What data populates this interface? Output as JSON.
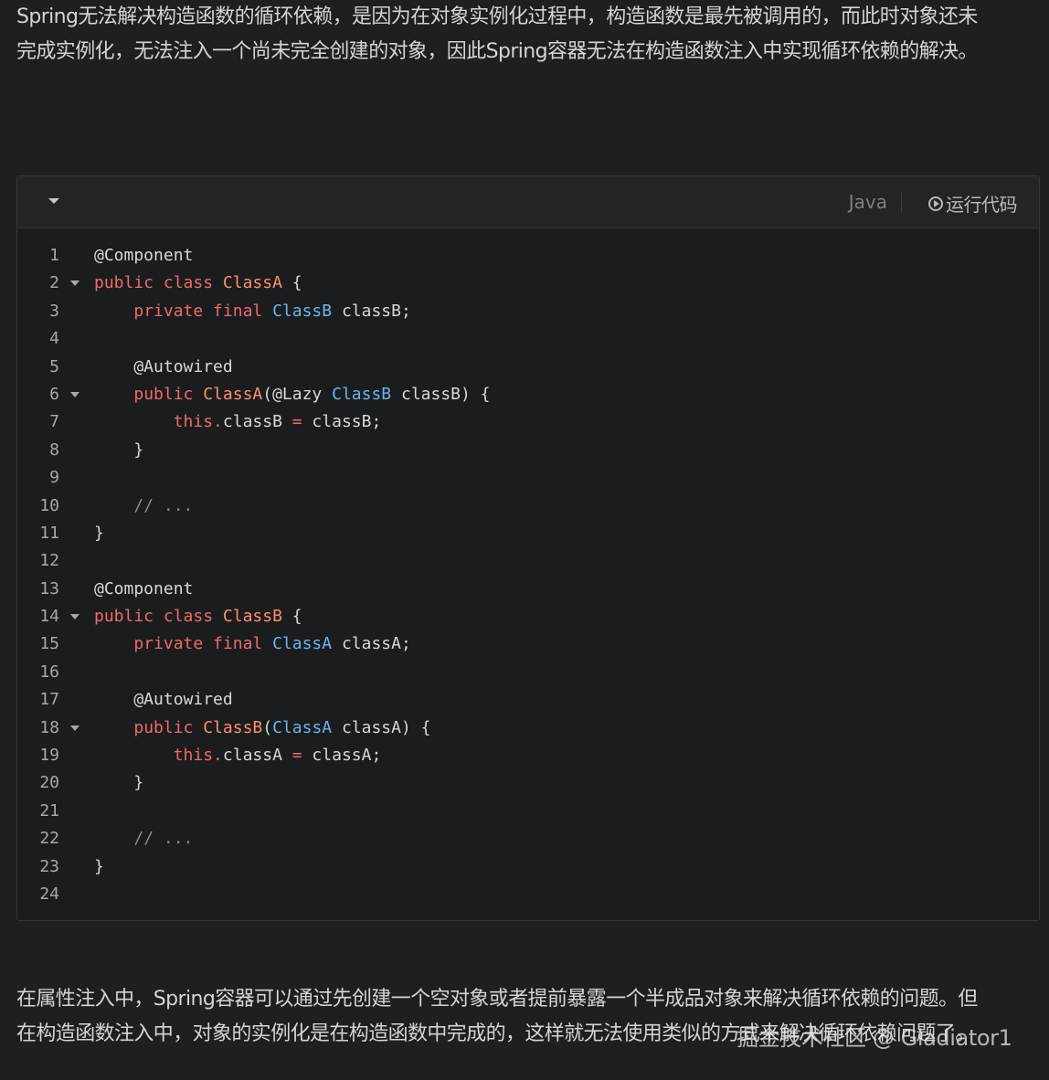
{
  "paragraph_top": {
    "lines": [
      "Spring无法解决构造函数的循环依赖，是因为在对象实例化过程中，构造函数是最先被调用的，而此时对象还未",
      "完成实例化，无法注入一个尚未完全创建的对象，因此Spring容器无法在构造函数注入中实现循环依赖的解决。"
    ]
  },
  "code_block": {
    "language": "Java",
    "run_label": "运行代码",
    "lines": [
      {
        "n": "1",
        "fold": false,
        "tokens": [
          {
            "t": "@Component",
            "c": "plain"
          }
        ]
      },
      {
        "n": "2",
        "fold": true,
        "tokens": [
          {
            "t": "public class ",
            "c": "kw"
          },
          {
            "t": "ClassA",
            "c": "cls"
          },
          {
            "t": " {",
            "c": "plain"
          }
        ]
      },
      {
        "n": "3",
        "fold": false,
        "tokens": [
          {
            "t": "    ",
            "c": "plain"
          },
          {
            "t": "private final ",
            "c": "kw"
          },
          {
            "t": "ClassB",
            "c": "type"
          },
          {
            "t": " classB;",
            "c": "plain"
          }
        ]
      },
      {
        "n": "4",
        "fold": false,
        "tokens": []
      },
      {
        "n": "5",
        "fold": false,
        "tokens": [
          {
            "t": "    @Autowired",
            "c": "plain"
          }
        ]
      },
      {
        "n": "6",
        "fold": true,
        "tokens": [
          {
            "t": "    ",
            "c": "plain"
          },
          {
            "t": "public ",
            "c": "kw"
          },
          {
            "t": "ClassA",
            "c": "cls"
          },
          {
            "t": "(@Lazy ",
            "c": "plain"
          },
          {
            "t": "ClassB",
            "c": "type"
          },
          {
            "t": " classB) {",
            "c": "plain"
          }
        ]
      },
      {
        "n": "7",
        "fold": false,
        "tokens": [
          {
            "t": "        ",
            "c": "plain"
          },
          {
            "t": "this.",
            "c": "kw"
          },
          {
            "t": "classB ",
            "c": "plain"
          },
          {
            "t": "=",
            "c": "kw"
          },
          {
            "t": " classB;",
            "c": "plain"
          }
        ]
      },
      {
        "n": "8",
        "fold": false,
        "tokens": [
          {
            "t": "    }",
            "c": "plain"
          }
        ]
      },
      {
        "n": "9",
        "fold": false,
        "tokens": []
      },
      {
        "n": "10",
        "fold": false,
        "tokens": [
          {
            "t": "    ",
            "c": "plain"
          },
          {
            "t": "// ...",
            "c": "comment"
          }
        ]
      },
      {
        "n": "11",
        "fold": false,
        "tokens": [
          {
            "t": "}",
            "c": "plain"
          }
        ]
      },
      {
        "n": "12",
        "fold": false,
        "tokens": []
      },
      {
        "n": "13",
        "fold": false,
        "tokens": [
          {
            "t": "@Component",
            "c": "plain"
          }
        ]
      },
      {
        "n": "14",
        "fold": true,
        "tokens": [
          {
            "t": "public class ",
            "c": "kw"
          },
          {
            "t": "ClassB",
            "c": "cls"
          },
          {
            "t": " {",
            "c": "plain"
          }
        ]
      },
      {
        "n": "15",
        "fold": false,
        "tokens": [
          {
            "t": "    ",
            "c": "plain"
          },
          {
            "t": "private final ",
            "c": "kw"
          },
          {
            "t": "ClassA",
            "c": "type"
          },
          {
            "t": " classA;",
            "c": "plain"
          }
        ]
      },
      {
        "n": "16",
        "fold": false,
        "tokens": []
      },
      {
        "n": "17",
        "fold": false,
        "tokens": [
          {
            "t": "    @Autowired",
            "c": "plain"
          }
        ]
      },
      {
        "n": "18",
        "fold": true,
        "tokens": [
          {
            "t": "    ",
            "c": "plain"
          },
          {
            "t": "public ",
            "c": "kw"
          },
          {
            "t": "ClassB",
            "c": "cls"
          },
          {
            "t": "(",
            "c": "plain"
          },
          {
            "t": "ClassA",
            "c": "type"
          },
          {
            "t": " classA) {",
            "c": "plain"
          }
        ]
      },
      {
        "n": "19",
        "fold": false,
        "tokens": [
          {
            "t": "        ",
            "c": "plain"
          },
          {
            "t": "this.",
            "c": "kw"
          },
          {
            "t": "classA ",
            "c": "plain"
          },
          {
            "t": "=",
            "c": "kw"
          },
          {
            "t": " classA;",
            "c": "plain"
          }
        ]
      },
      {
        "n": "20",
        "fold": false,
        "tokens": [
          {
            "t": "    }",
            "c": "plain"
          }
        ]
      },
      {
        "n": "21",
        "fold": false,
        "tokens": []
      },
      {
        "n": "22",
        "fold": false,
        "tokens": [
          {
            "t": "    ",
            "c": "plain"
          },
          {
            "t": "// ...",
            "c": "comment"
          }
        ]
      },
      {
        "n": "23",
        "fold": false,
        "tokens": [
          {
            "t": "}",
            "c": "plain"
          }
        ]
      },
      {
        "n": "24",
        "fold": false,
        "tokens": []
      }
    ]
  },
  "paragraph_bottom": {
    "lines": [
      "在属性注入中，Spring容器可以通过先创建一个空对象或者提前暴露一个半成品对象来解决循环依赖的问题。但",
      "在构造函数注入中，对象的实例化是在构造函数中完成的，这样就无法使用类似的方式来解决循环依赖问题了。"
    ]
  },
  "watermark": "掘金技术社区 @ Gladiator1",
  "colors": {
    "background": "#1e1f21",
    "keyword": "#ef6a6a",
    "type": "#6cb4f0",
    "class_name": "#ff8f6a",
    "comment": "#8a8c90"
  }
}
